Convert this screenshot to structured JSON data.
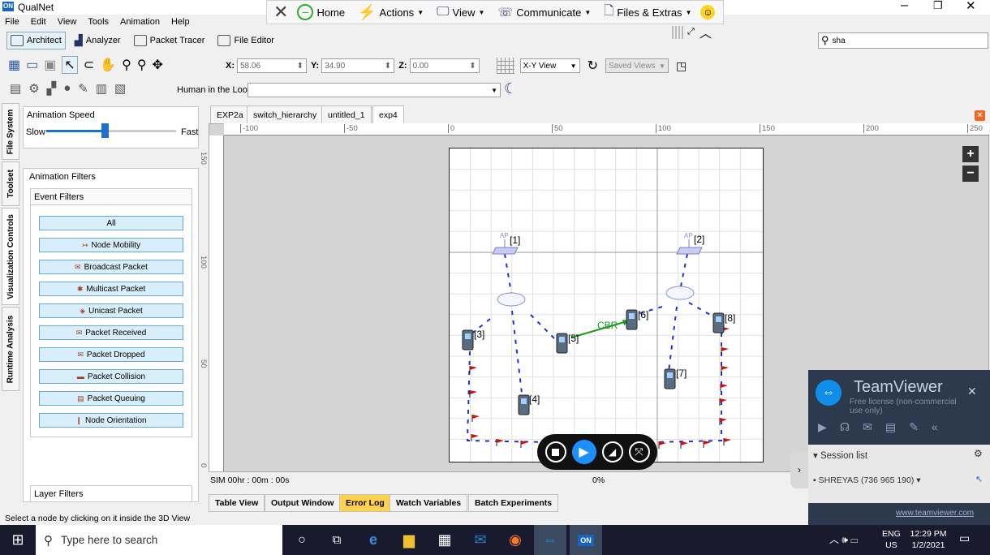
{
  "app": {
    "title": "QualNet",
    "logo_text": "ON"
  },
  "menu": [
    "File",
    "Edit",
    "View",
    "Tools",
    "Animation",
    "Help"
  ],
  "main_toolbar": {
    "home": "Home",
    "actions": "Actions",
    "view": "View",
    "communicate": "Communicate",
    "files_extras": "Files & Extras"
  },
  "modes": {
    "architect": "Architect",
    "analyzer": "Analyzer",
    "packet_tracer": "Packet Tracer",
    "file_editor": "File Editor"
  },
  "search": {
    "value": "sha"
  },
  "coords": {
    "x_label": "X:",
    "x": "58.06",
    "y_label": "Y:",
    "y": "34.90",
    "z_label": "Z:",
    "z": "0.00",
    "view_mode": "X-Y View",
    "saved_views": "Saved Views"
  },
  "hitl": {
    "label": "Human in the Loop:",
    "value": ""
  },
  "side_tabs": [
    "File System",
    "Toolset",
    "Visualization Controls",
    "Runtime Analysis"
  ],
  "anim": {
    "speed_label": "Animation Speed",
    "slow": "Slow",
    "fast": "Fast",
    "speed_level": 0.45,
    "filters_label": "Animation Filters",
    "event_filters": "Event Filters",
    "filters": [
      {
        "label": "All",
        "icon": ""
      },
      {
        "label": "Node Mobility",
        "icon": "↣"
      },
      {
        "label": "Broadcast Packet",
        "icon": "✉"
      },
      {
        "label": "Multicast Packet",
        "icon": "✱"
      },
      {
        "label": "Unicast Packet",
        "icon": "◈"
      },
      {
        "label": "Packet Received",
        "icon": "✉"
      },
      {
        "label": "Packet Dropped",
        "icon": "✉"
      },
      {
        "label": "Packet Collision",
        "icon": "▬"
      },
      {
        "label": "Packet Queuing",
        "icon": "▤"
      },
      {
        "label": "Node Orientation",
        "icon": "❙"
      }
    ],
    "layer_filters": "Layer Filters"
  },
  "tabs": [
    "EXP2a",
    "switch_hierarchy",
    "untitled_1",
    "exp4"
  ],
  "ruler_top": [
    "-100",
    "-50",
    "0",
    "50",
    "100",
    "150",
    "200",
    "250"
  ],
  "ruler_left": [
    "150",
    "100",
    "50",
    "0"
  ],
  "nodes": {
    "ap1": "[1]",
    "ap2": "[2]",
    "ap1_tag": "AP",
    "ap2_tag": "AP",
    "n3": "[3]",
    "n4": "[4]",
    "n5": "[5]",
    "n6": "[6]",
    "n7": "[7]",
    "n8": "[8]",
    "cbr": "CBR"
  },
  "sim": {
    "time": "SIM 00hr : 00m : 00s",
    "progress": "0%"
  },
  "bottom_tabs": [
    "Table View",
    "Output Window",
    "Error Log",
    "Watch Variables",
    "Batch Experiments"
  ],
  "status": "Select a node by clicking on it inside the 3D View",
  "teamviewer": {
    "brand": "TeamViewer",
    "license": "Free license (non-commercial use only)",
    "session_list": "Session list",
    "session_item": "SHREYAS (736 965 190)",
    "link": "www.teamviewer.com"
  },
  "taskbar": {
    "search_placeholder": "Type here to search",
    "lang": "ENG",
    "region": "US",
    "time": "12:29 PM",
    "date": "1/2/2021"
  },
  "colors": {
    "filter_bg": "#d8eefa",
    "error_tab": "#ffd24d",
    "link_green": "#1a9a1a",
    "link_blue": "#2233cc",
    "taskbar": "#1a1a2e"
  }
}
